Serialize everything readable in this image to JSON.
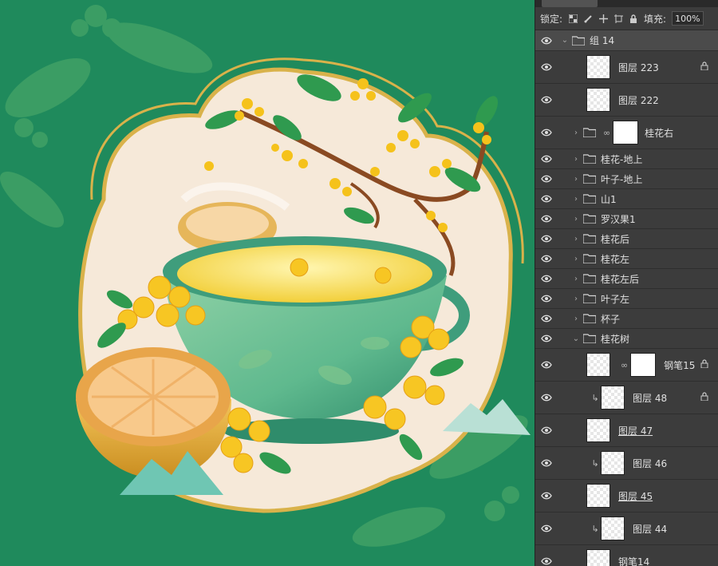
{
  "canvas": {
    "bg_color": "#1f8a5c",
    "cream_color": "#f6e9d9",
    "gold_color": "#d9b24a"
  },
  "panel": {
    "lock_label": "锁定:",
    "fill_label": "填充:",
    "fill_value": "100%",
    "lock_icons": [
      "lock-transparent-icon",
      "lock-brush-icon",
      "lock-move-icon",
      "lock-artboard-icon",
      "lock-all-icon"
    ],
    "layers": [
      {
        "name": "组 14",
        "kind": "group-open",
        "indent": 0,
        "selected": true
      },
      {
        "name": "图层 223",
        "kind": "layer",
        "indent": 1,
        "locked": true
      },
      {
        "name": "图层 222",
        "kind": "layer",
        "indent": 1
      },
      {
        "name": "桂花右",
        "kind": "group-masked",
        "indent": 1
      },
      {
        "name": "桂花-地上",
        "kind": "group",
        "indent": 1
      },
      {
        "name": "叶子-地上",
        "kind": "group",
        "indent": 1
      },
      {
        "name": "山1",
        "kind": "group",
        "indent": 1
      },
      {
        "name": "罗汉果1",
        "kind": "group",
        "indent": 1
      },
      {
        "name": "桂花后",
        "kind": "group",
        "indent": 1
      },
      {
        "name": "桂花左",
        "kind": "group",
        "indent": 1
      },
      {
        "name": "桂花左后",
        "kind": "group",
        "indent": 1
      },
      {
        "name": "叶子左",
        "kind": "group",
        "indent": 1
      },
      {
        "name": "杯子",
        "kind": "group",
        "indent": 1
      },
      {
        "name": "桂花树",
        "kind": "group-open",
        "indent": 1
      },
      {
        "name": "钢笔15",
        "kind": "masked-layer",
        "indent": 2,
        "locked": true
      },
      {
        "name": "图层 48",
        "kind": "clipped",
        "indent": 2,
        "locked": true
      },
      {
        "name": "图层 47",
        "kind": "layer",
        "indent": 2,
        "underline": true
      },
      {
        "name": "图层 46",
        "kind": "clipped",
        "indent": 2
      },
      {
        "name": "图层 45",
        "kind": "layer",
        "indent": 2,
        "underline": true
      },
      {
        "name": "图层 44",
        "kind": "clipped",
        "indent": 2
      },
      {
        "name": "钢笔14",
        "kind": "layer",
        "indent": 2
      }
    ]
  }
}
